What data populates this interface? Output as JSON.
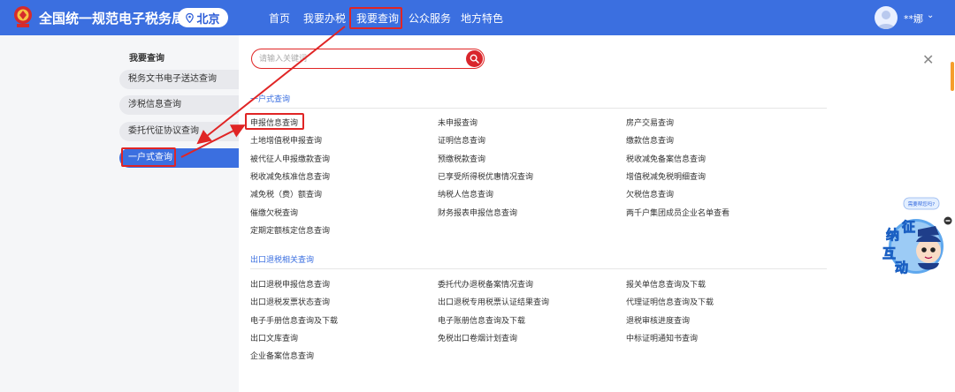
{
  "header": {
    "site_title": "全国统一规范电子税务局",
    "region": "北京",
    "nav": [
      "首页",
      "我要办税",
      "我要查询",
      "公众服务",
      "地方特色"
    ],
    "user_name": "**娜",
    "user_chevron": "⌄"
  },
  "sidebar": {
    "title": "我要查询",
    "items": [
      "税务文书电子送达查询",
      "涉税信息查询",
      "委托代征协议查询",
      "一户式查询"
    ]
  },
  "search": {
    "placeholder": "请输入关键词"
  },
  "close_glyph": "✕",
  "sections": [
    {
      "title": "一户式查询",
      "links": [
        "申报信息查询",
        "未申报查询",
        "房产交易查询",
        "土地增值税申报查询",
        "证明信息查询",
        "缴款信息查询",
        "被代征人申报缴款查询",
        "预缴税款查询",
        "税收减免备案信息查询",
        "税收减免核准信息查询",
        "已享受所得税优惠情况查询",
        "增值税减免税明细查询",
        "减免税（费）额查询",
        "纳税人信息查询",
        "欠税信息查询",
        "催缴欠税查询",
        "财务报表申报信息查询",
        "两千户集团成员企业名单查看",
        "定期定额核定信息查询"
      ]
    },
    {
      "title": "出口退税相关查询",
      "links": [
        "出口退税申报信息查询",
        "委托代办退税备案情况查询",
        "报关单信息查询及下载",
        "出口退税发票状态查询",
        "出口退税专用税票认证结果查询",
        "代理证明信息查询及下载",
        "电子手册信息查询及下载",
        "电子账册信息查询及下载",
        "退税审核进度查询",
        "出口文库查询",
        "免税出口卷烟计划查询",
        "中标证明通知书查询",
        "企业备案信息查询"
      ]
    }
  ],
  "mascot": {
    "bubble": "需要帮您吗?",
    "chars": [
      "征",
      "纳",
      "互",
      "动"
    ]
  },
  "colors": {
    "brand": "#3b6fe0",
    "annotation_red": "#e02525",
    "search_red": "#d9262c"
  }
}
